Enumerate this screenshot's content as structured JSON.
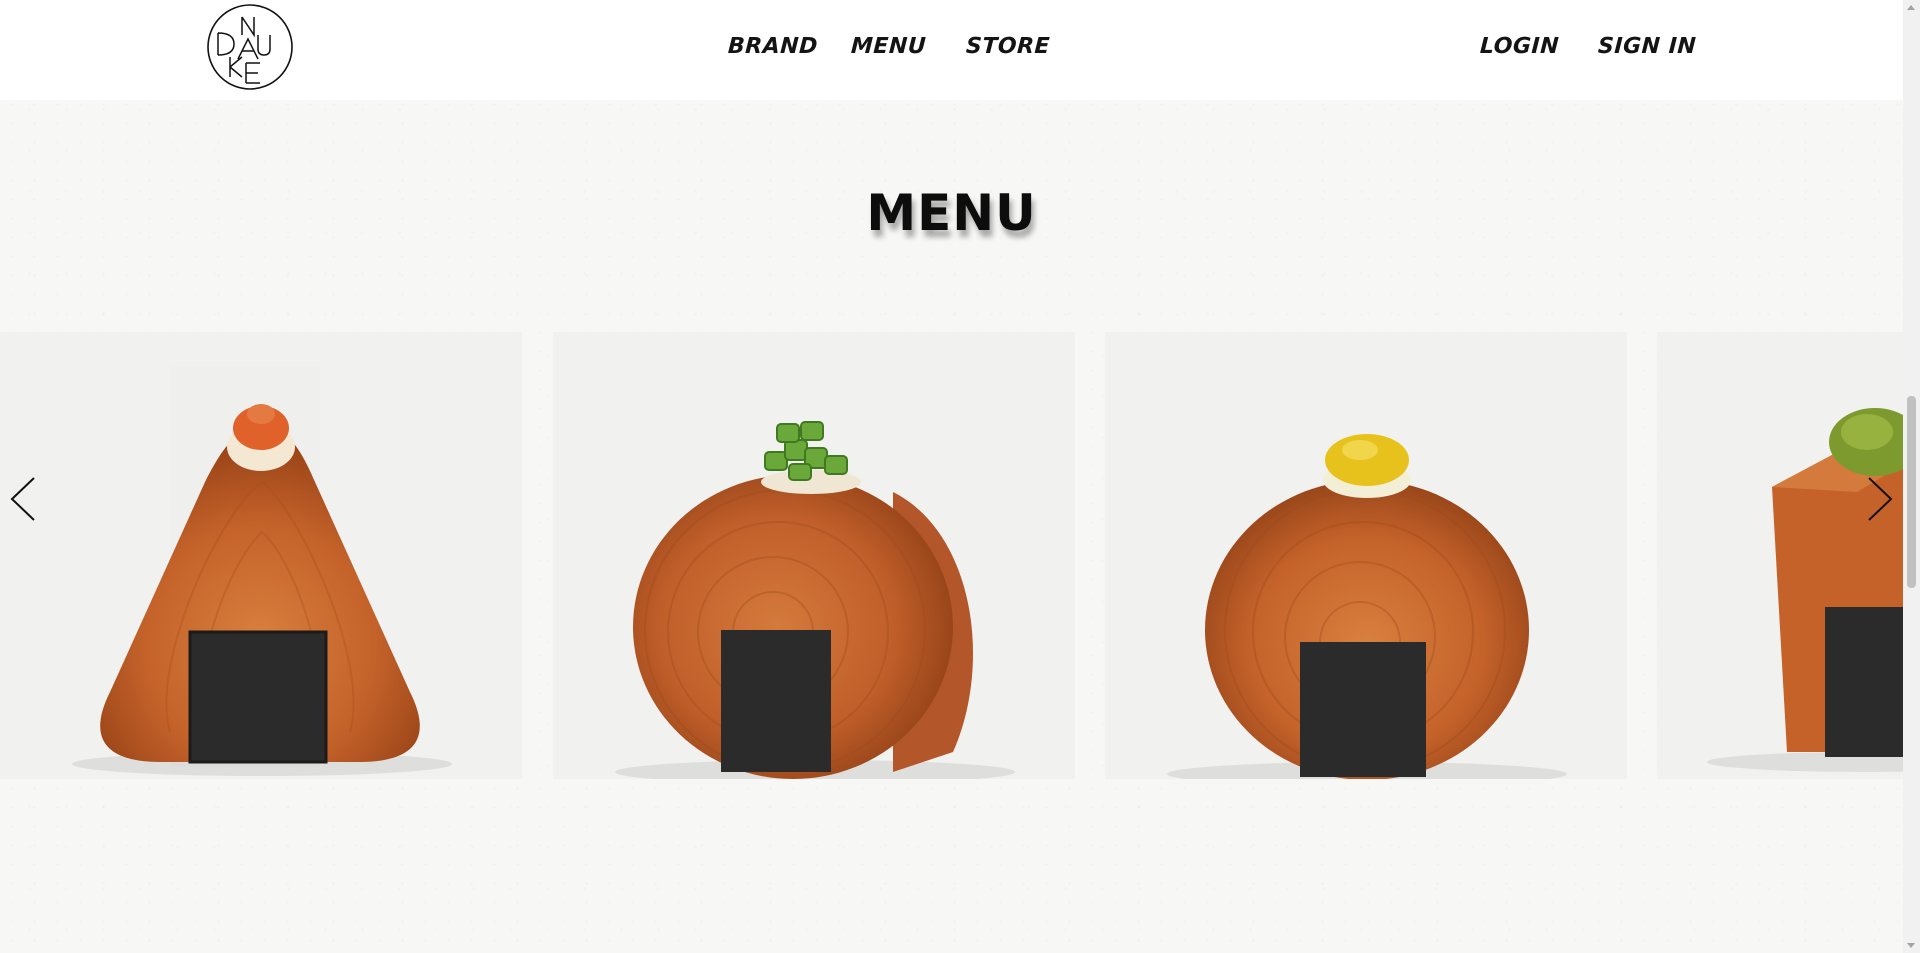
{
  "nav": {
    "brand": "BRAND",
    "menu": "MENU",
    "store": "STORE",
    "login": "LOGIN",
    "signin": "SIGN IN"
  },
  "logo": {
    "letters": "N U D K A E"
  },
  "section": {
    "title": "MENU"
  },
  "carousel": {
    "items": [
      {
        "shape": "triangle",
        "topping": "spicy-mayo",
        "topping_color": "#e0622a"
      },
      {
        "shape": "round",
        "topping": "green-onion",
        "topping_color": "#6aa83a"
      },
      {
        "shape": "round",
        "topping": "yuzu",
        "topping_color": "#e8c21c"
      },
      {
        "shape": "cube",
        "topping": "matcha",
        "topping_color": "#7c9a2e"
      }
    ],
    "prev_icon": "chevron-left-icon",
    "next_icon": "chevron-right-icon"
  },
  "colors": {
    "background": "#f7f7f5",
    "header": "#ffffff",
    "pastry": "#c8652b",
    "nori": "#2a2a2a",
    "text": "#141414"
  }
}
